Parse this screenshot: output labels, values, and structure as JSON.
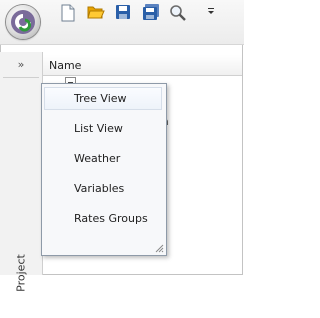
{
  "toolbar": {
    "logo_icon": "app-logo-icon",
    "buttons": [
      {
        "name": "new-document",
        "icon": "new-file-icon"
      },
      {
        "name": "open",
        "icon": "open-folder-icon"
      },
      {
        "name": "save",
        "icon": "save-icon"
      },
      {
        "name": "save-all",
        "icon": "save-all-icon"
      },
      {
        "name": "search",
        "icon": "search-icon"
      },
      {
        "name": "customize",
        "icon": "dropdown-arrow-icon"
      }
    ]
  },
  "sidebar": {
    "collapse_label": "»",
    "project_tab_label": "Project"
  },
  "main": {
    "column_header": "Name",
    "partial_text": "a"
  },
  "menu": {
    "items": [
      {
        "label": "Tree View",
        "highlighted": true
      },
      {
        "label": "List View"
      },
      {
        "label": "Weather"
      },
      {
        "label": "Variables"
      },
      {
        "label": "Rates Groups"
      }
    ]
  },
  "colors": {
    "accent": "#f3b400",
    "save_blue": "#2a5fa8",
    "menu_border": "#8e9aa8"
  }
}
